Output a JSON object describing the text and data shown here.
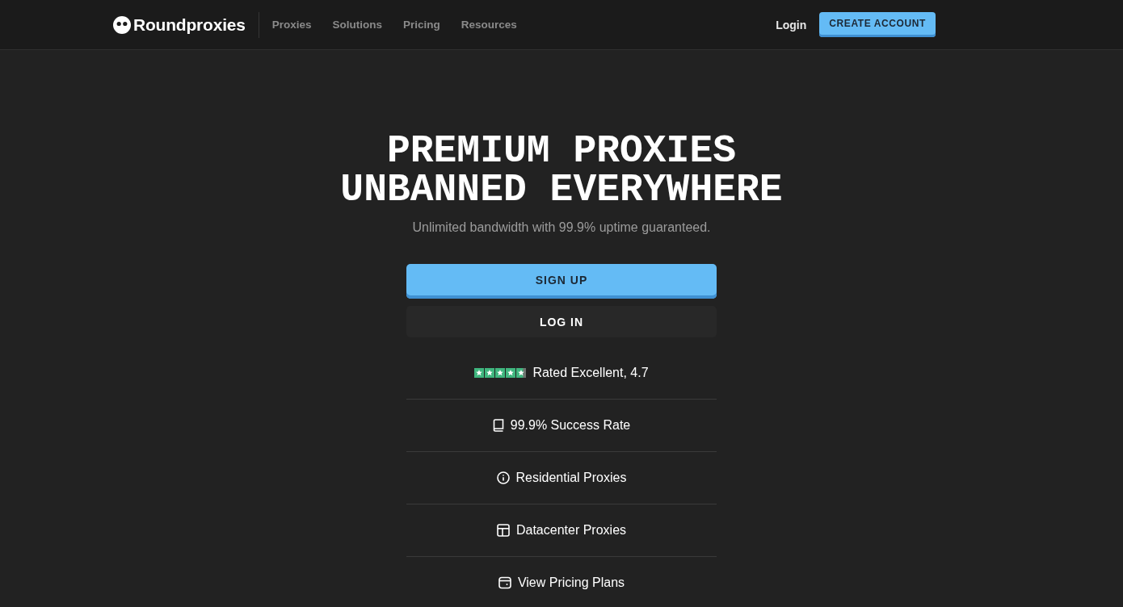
{
  "header": {
    "logo": "Roundproxies",
    "nav": [
      "Proxies",
      "Solutions",
      "Pricing",
      "Resources"
    ],
    "login": "Login",
    "cta": "CREATE ACCOUNT"
  },
  "hero": {
    "title": "PREMIUM PROXIES UNBANNED EVERYWHERE",
    "subtitle": "Unlimited bandwidth with 99.9% uptime guaranteed.",
    "primary_button": "SIGN UP",
    "secondary_button": "LOG IN",
    "rating": {
      "stars": 4.7,
      "text": "Rated Excellent, 4.7"
    },
    "features": [
      "99.9% Success Rate",
      "Residential Proxies",
      "Datacenter Proxies",
      "View Pricing Plans"
    ]
  }
}
